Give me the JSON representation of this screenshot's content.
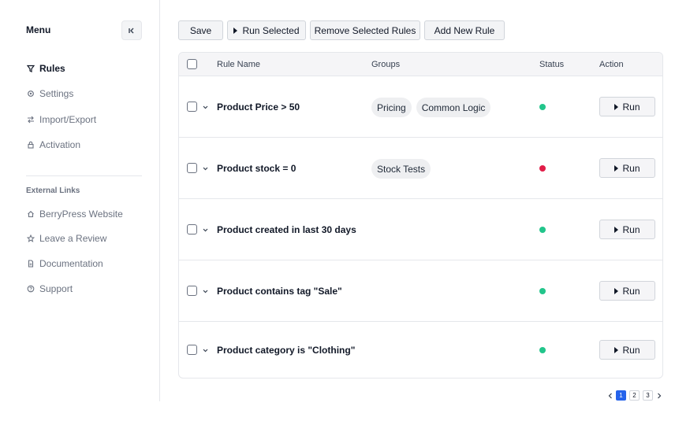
{
  "sidebar": {
    "title": "Menu",
    "items": [
      {
        "label": "Rules",
        "icon": "filter-icon",
        "active": true
      },
      {
        "label": "Settings",
        "icon": "gear-icon"
      },
      {
        "label": "Import/Export",
        "icon": "swap-arrows-icon"
      },
      {
        "label": "Activation",
        "icon": "lock-icon"
      }
    ],
    "section_title": "External Links",
    "links": [
      {
        "label": "BerryPress Website",
        "icon": "home-icon"
      },
      {
        "label": "Leave a Review",
        "icon": "star-icon"
      },
      {
        "label": "Documentation",
        "icon": "document-icon"
      },
      {
        "label": "Support",
        "icon": "help-circle-icon"
      }
    ]
  },
  "toolbar": {
    "save_label": "Save",
    "run_selected_label": "Run Selected",
    "remove_selected_label": "Remove Selected Rules",
    "add_new_label": "Add New Rule"
  },
  "table": {
    "columns": {
      "name": "Rule Name",
      "groups": "Groups",
      "status": "Status",
      "action": "Action"
    },
    "rows": [
      {
        "name": "Product Price > 50",
        "groups": [
          "Pricing",
          "Common Logic"
        ],
        "status": "active",
        "status_color": "#22c58b",
        "action": "Run"
      },
      {
        "name": "Product stock = 0",
        "groups": [
          "Stock Tests"
        ],
        "status": "inactive",
        "status_color": "#e11d48",
        "action": "Run"
      },
      {
        "name": "Product created in last 30 days",
        "groups": [],
        "status": "active",
        "status_color": "#22c58b",
        "action": "Run"
      },
      {
        "name": "Product contains tag \"Sale\"",
        "groups": [],
        "status": "active",
        "status_color": "#22c58b",
        "action": "Run"
      },
      {
        "name": "Product category is \"Clothing\"",
        "groups": [],
        "status": "active",
        "status_color": "#22c58b",
        "action": "Run"
      }
    ]
  },
  "pagination": {
    "pages": [
      "1",
      "2",
      "3"
    ],
    "current": "1"
  },
  "colors": {
    "accent": "#2563eb",
    "status_active": "#22c58b",
    "status_inactive": "#e11d48"
  }
}
